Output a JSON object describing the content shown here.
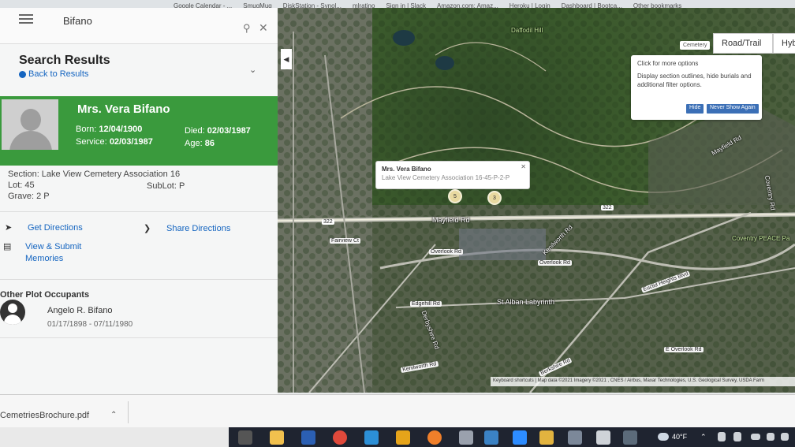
{
  "bookmarks": [
    "Google Calendar - ...",
    "SmugMug",
    "DiskStation - Synol...",
    "mlratino",
    "Sign in | Slack",
    "Amazon.com: Amaz...",
    "Heroku | Login",
    "Dashboard | Bootca...",
    "Other bookmarks"
  ],
  "search": {
    "value": "Bifano"
  },
  "results": {
    "title": "Search Results",
    "back_label": "Back to Results"
  },
  "person": {
    "name": "Mrs. Vera Bifano",
    "born_label": "Born:",
    "born": "12/04/1900",
    "died_label": "Died:",
    "died": "02/03/1987",
    "service_label": "Service:",
    "service": "02/03/1987",
    "age_label": "Age:",
    "age": "86"
  },
  "plot": {
    "section": "Section: Lake View Cemetery Association 16",
    "lot": "Lot: 45",
    "sublot": "SubLot: P",
    "grave": "Grave: 2 P"
  },
  "actions": {
    "directions": "Get Directions",
    "share": "Share Directions",
    "memories_line1": "View & Submit",
    "memories_line2": "Memories"
  },
  "occupants": {
    "title": "Other Plot Occupants",
    "items": [
      {
        "name": "Angelo R. Bifano",
        "dates": "01/17/1898 - 07/11/1980"
      }
    ]
  },
  "map": {
    "tabs": [
      "Road/Trail",
      "Hyb"
    ],
    "cemetery_tag": "Cemetery",
    "tooltip": {
      "line1": "Click for more options",
      "line2": "Display section outlines, hide burials and additional filter options.",
      "hide": "Hide",
      "never": "Never Show Again"
    },
    "popup": {
      "name": "Mrs. Vera Bifano",
      "location": "Lake View Cemetery Association 16-45-P-2-P"
    },
    "pins": [
      "5",
      "3"
    ],
    "labels": [
      "Mayfield Rd",
      "Overlook Rd",
      "Edgehill Rd",
      "St Alban Labyrinth",
      "Euclid Heights Blvd",
      "Kenilworth Rd",
      "Fairview Ct",
      "Coventry PEACE Pa",
      "Mayfield Rd",
      "Overlook Rd",
      "Derbyshire Rd",
      "Kenilworth Rd",
      "Berkshire Rd",
      "E Overlook Rd",
      "Coventry Rd",
      "Daffodil Hill"
    ],
    "shields": [
      "322",
      "322"
    ],
    "attribution": "Keyboard shortcuts  |  Map data ©2021 Imagery ©2021 , CNES / Airbus, Maxar Technologies, U.S. Geological Survey, USDA Farm"
  },
  "downloads": {
    "file": "CemetriesBrochure.pdf"
  },
  "taskbar": {
    "weather": "40°F"
  }
}
